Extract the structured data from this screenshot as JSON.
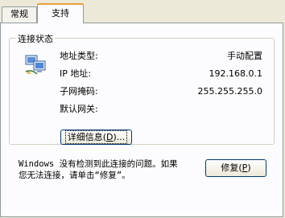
{
  "tabs": [
    {
      "label": "常规",
      "active": false
    },
    {
      "label": "支持",
      "active": true
    }
  ],
  "group": {
    "title": "连接状态",
    "rows": [
      {
        "label": "地址类型:",
        "value": "手动配置"
      },
      {
        "label": "IP 地址:",
        "value": "192.168.0.1"
      },
      {
        "label": "子网掩码:",
        "value": "255.255.255.0"
      },
      {
        "label": "默认网关:",
        "value": ""
      }
    ],
    "details_button": {
      "label": "详细信息",
      "mnemonic": "D",
      "suffix": "..."
    }
  },
  "message": {
    "line1": "Windows 没有检测到此连接的问题。如果",
    "line2": "您无法连接，请单击“修复”。"
  },
  "repair_button": {
    "label": "修复",
    "mnemonic": "P"
  },
  "icons": {
    "connection": "network-computer-icon"
  }
}
